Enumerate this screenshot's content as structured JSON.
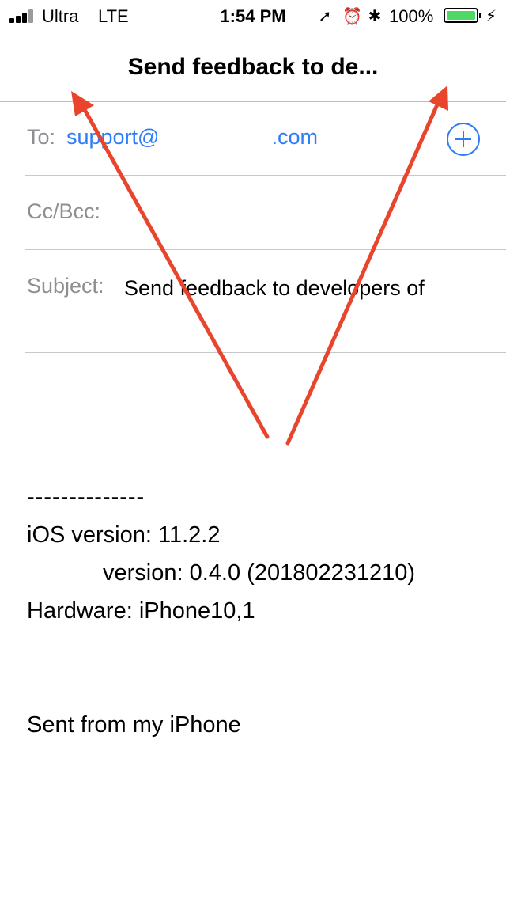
{
  "status_bar": {
    "carrier": "Ultra",
    "network": "LTE",
    "time": "1:54 PM",
    "battery_percent": "100%",
    "icons": [
      "signal-icon",
      "location-icon",
      "alarm-icon",
      "bluetooth-icon",
      "battery-icon",
      "charging-bolt-icon"
    ],
    "location_glyph": "➚",
    "alarm_glyph": "⏰",
    "bluetooth_glyph": "✱",
    "bolt_glyph": "⚡",
    "battery_color": "#4cd964"
  },
  "nav": {
    "title": "Send feedback to de..."
  },
  "compose": {
    "to_label": "To:",
    "to_value_start": "support@",
    "to_value_end": ".com",
    "cc_label": "Cc/Bcc:",
    "subject_label": "Subject:",
    "subject_value": "Send feedback to developers of",
    "add_button_icon": "plus-circle-icon",
    "accent_color": "#2e7cf6"
  },
  "body": {
    "separator": "--------------",
    "ios_version": "iOS version: 11.2.2",
    "app_version": "version: 0.4.0 (201802231210)",
    "hardware": "Hardware: iPhone10,1",
    "signature": "Sent from my iPhone"
  },
  "annotations": {
    "arrow_color": "#e8452c"
  }
}
